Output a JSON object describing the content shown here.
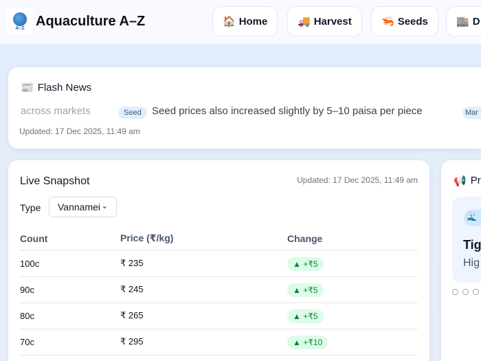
{
  "header": {
    "logo_text": "A–Z",
    "brand": "Aquaculture A–Z",
    "nav": [
      {
        "icon": "🏠",
        "label": "Home"
      },
      {
        "icon": "🚚",
        "label": "Harvest"
      },
      {
        "icon": "🦐",
        "label": "Seeds"
      },
      {
        "icon": "🏬",
        "label": "D"
      }
    ]
  },
  "flash": {
    "title": "Flash News",
    "icon": "📰",
    "items": [
      {
        "text": "across markets"
      },
      {
        "tag": "Seed",
        "text": "Seed prices also increased slightly by 5–10 paisa per piece"
      },
      {
        "tag": "Mar"
      }
    ],
    "updated": "Updated: 17 Dec 2025, 11:49 am"
  },
  "snapshot": {
    "title": "Live Snapshot",
    "updated": "Updated: 17 Dec 2025, 11:49 am",
    "type_label": "Type",
    "type_value": "Vannamei",
    "columns": [
      "Count",
      "Price (₹/kg)",
      "Change"
    ],
    "rows": [
      {
        "count": "100c",
        "price": "₹ 235",
        "change": "▲ +₹5"
      },
      {
        "count": "90c",
        "price": "₹ 245",
        "change": "▲ +₹5"
      },
      {
        "count": "80c",
        "price": "₹ 265",
        "change": "▲ +₹5"
      },
      {
        "count": "70c",
        "price": "₹ 295",
        "change": "▲ +₹10"
      }
    ]
  },
  "promo": {
    "icon": "📢",
    "title": "Pr",
    "pill_icon": "🌊",
    "slide_title": "Tig",
    "slide_sub": "Hig"
  }
}
